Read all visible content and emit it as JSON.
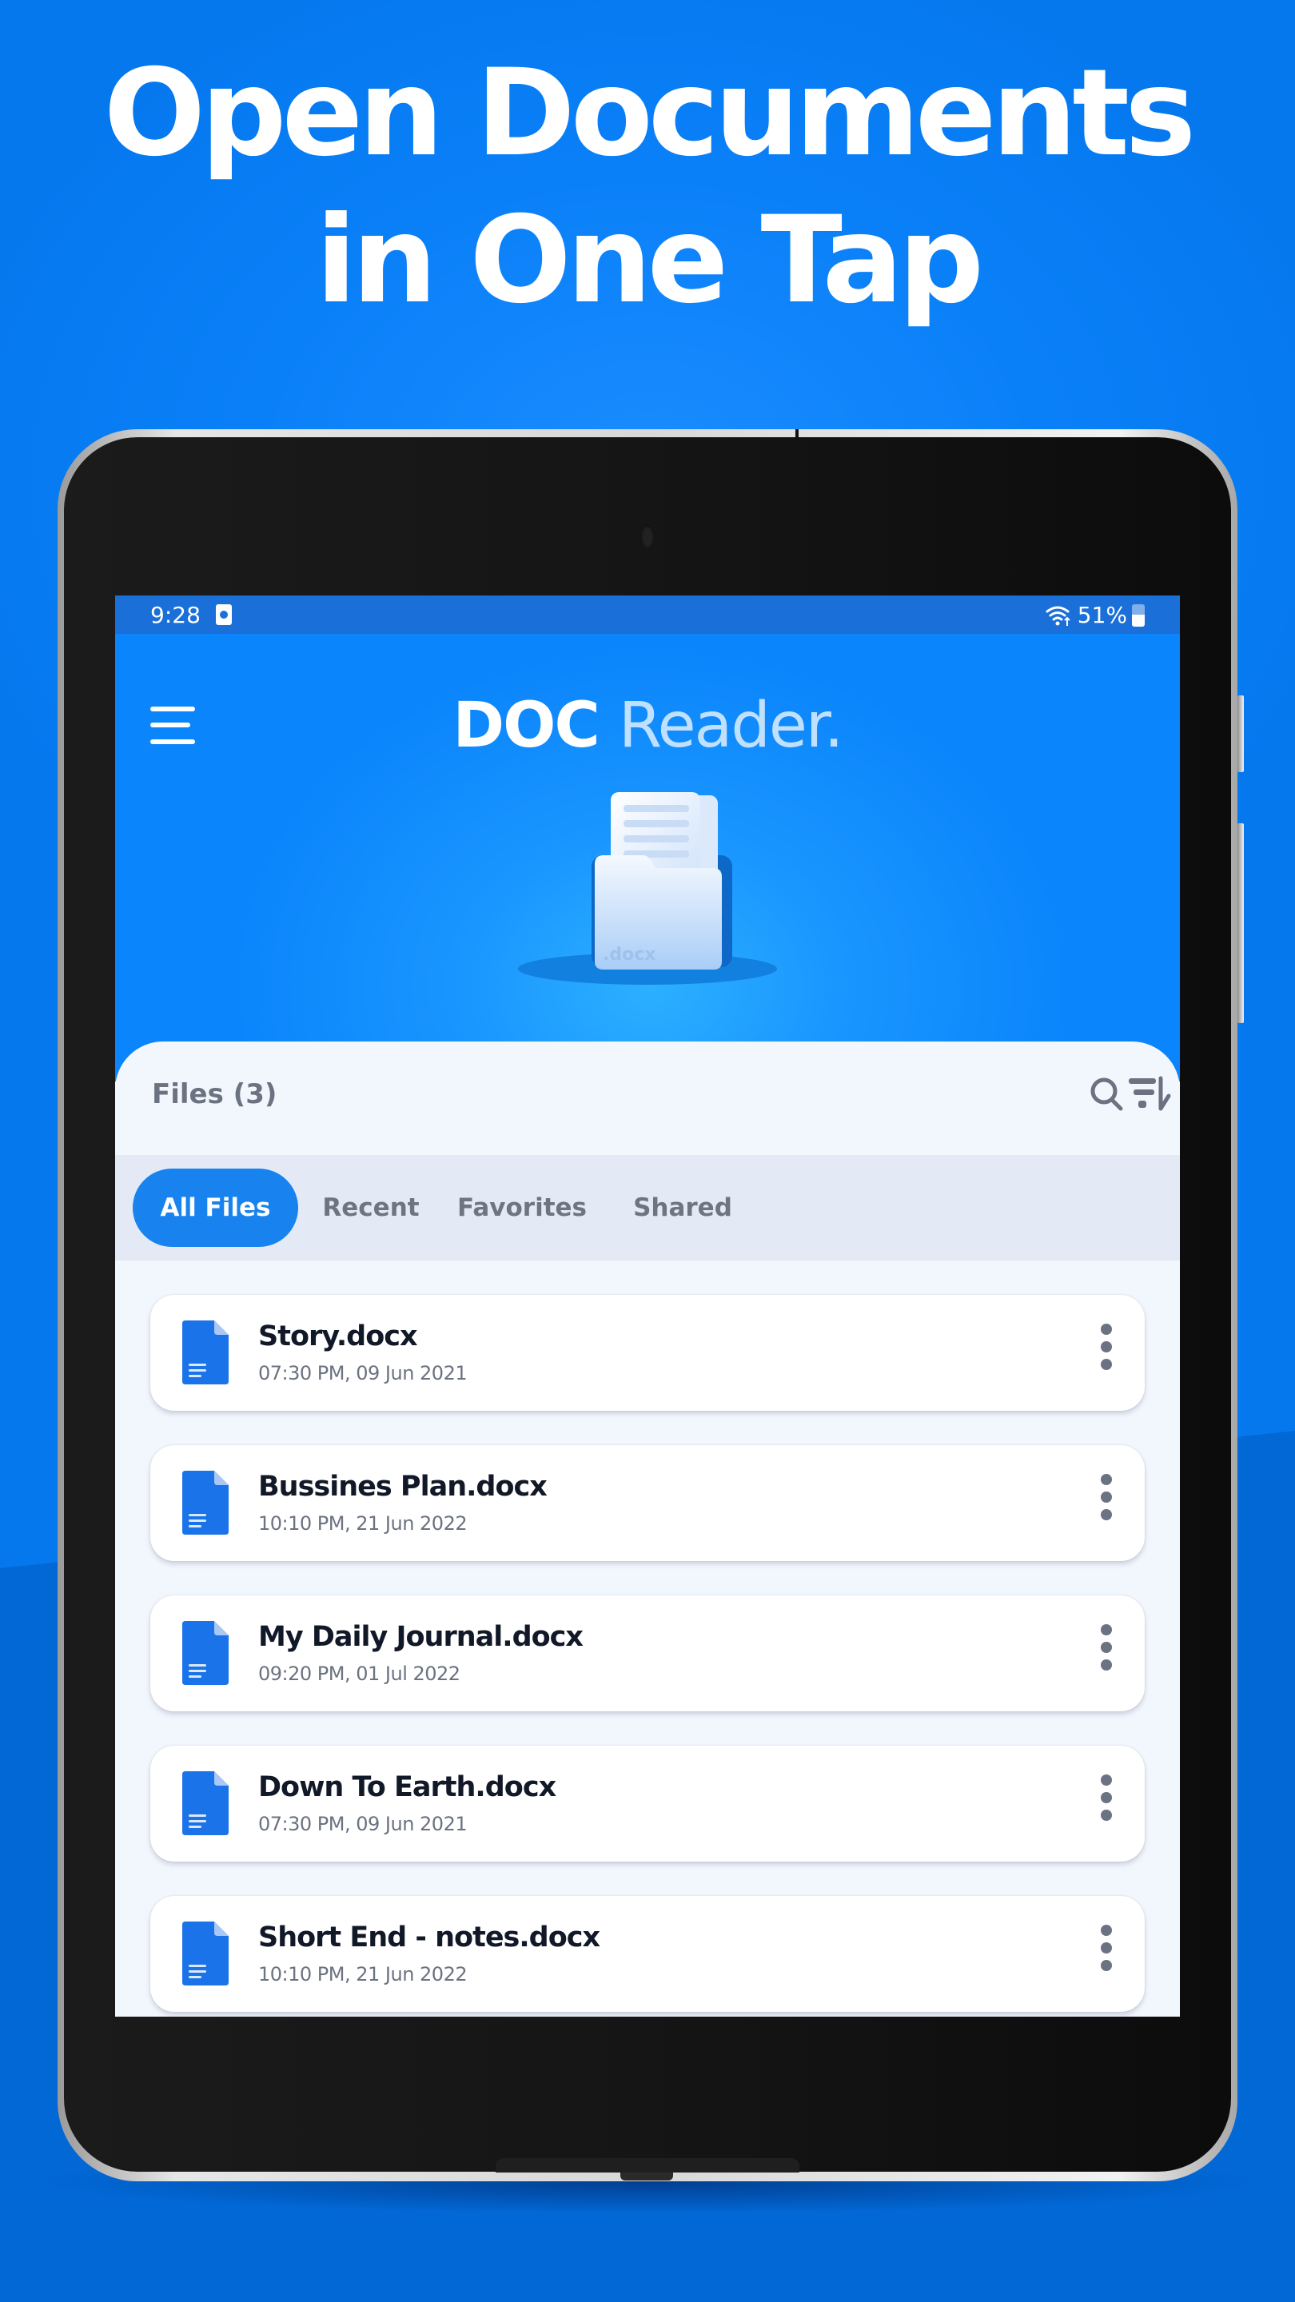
{
  "headline": {
    "line1": "Open Documents",
    "line2": "in One Tap"
  },
  "status_bar": {
    "time": "9:28",
    "battery_text": "51%",
    "battery_level": 0.51,
    "icons": [
      "notification-icon",
      "wifi-icon",
      "battery-icon"
    ]
  },
  "app": {
    "title_part1": "DOC",
    "title_part2": "Reader.",
    "menu_icon": "hamburger-menu-icon",
    "illustration_label": ".docx"
  },
  "files_section": {
    "heading": "Files (3)",
    "search_icon": "search-icon",
    "sort_icon": "sort-icon"
  },
  "tabs": [
    {
      "label": "All Files",
      "active": true
    },
    {
      "label": "Recent",
      "active": false
    },
    {
      "label": "Favorites",
      "active": false
    },
    {
      "label": "Shared",
      "active": false
    }
  ],
  "files": [
    {
      "name": "Story.docx",
      "date": "07:30 PM, 09 Jun 2021"
    },
    {
      "name": "Bussines Plan.docx",
      "date": "10:10 PM, 21 Jun 2022"
    },
    {
      "name": "My Daily Journal.docx",
      "date": "09:20 PM, 01 Jul 2022"
    },
    {
      "name": "Down To Earth.docx",
      "date": "07:30 PM, 09 Jun 2021"
    },
    {
      "name": "Short End - notes.docx",
      "date": "10:10 PM, 21 Jun 2022"
    }
  ],
  "colors": {
    "accent": "#1883ef",
    "background": "#0a80f8",
    "status_bar": "#1b6fd8",
    "doc_icon": "#1a73e8"
  }
}
